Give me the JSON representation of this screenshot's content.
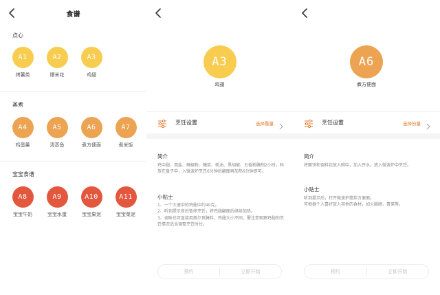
{
  "panel1": {
    "title": "食谱",
    "sections": [
      {
        "title": "点心",
        "items": [
          {
            "code": "A1",
            "name": "烤薯类",
            "color": "#f7cc4f"
          },
          {
            "code": "A2",
            "name": "爆米花",
            "color": "#f7cc4f"
          },
          {
            "code": "A3",
            "name": "鸡翅",
            "color": "#f7cc4f"
          }
        ]
      },
      {
        "title": "蒸煮",
        "items": [
          {
            "code": "A4",
            "name": "鸡蛋羹",
            "color": "#eca352"
          },
          {
            "code": "A5",
            "name": "清蒸鱼",
            "color": "#eca352"
          },
          {
            "code": "A6",
            "name": "煮方便面",
            "color": "#eca352"
          },
          {
            "code": "A7",
            "name": "煮米饭",
            "color": "#eca352"
          }
        ]
      },
      {
        "title": "宝宝食谱",
        "items": [
          {
            "code": "A8",
            "name": "宝宝牛奶",
            "color": "#e2573d"
          },
          {
            "code": "A9",
            "name": "宝宝水蛋",
            "color": "#e2573d"
          },
          {
            "code": "A10",
            "name": "宝宝果泥",
            "color": "#e2573d"
          },
          {
            "code": "A11",
            "name": "宝宝菜泥",
            "color": "#e2573d"
          }
        ]
      }
    ]
  },
  "panel2": {
    "code": "A3",
    "name": "鸡翅",
    "settings_label": "烹饪设置",
    "settings_hint": "选择重量",
    "intro_title": "简介",
    "intro_text": "鸡中翅、用盐、辣椒粉、糖浆、蚝油、黑胡椒、五香粉腌制2小时，码放在盘子中，入微波炉烹饪6分钟后翻面再加热6分钟即可。",
    "tips_title": "小贴士",
    "tips": [
      "1、一个大速中的鸡翅中约40克。",
      "2、听到提示音后暂停烹饪，将鸡翅翻面后继续加热。",
      "3、调味也可直接用奥尔良腌料，鸡翅大小不同，需注意观察鸡翅的烹饪情况适当调整烹饪时长。"
    ],
    "btn_schedule": "预约",
    "btn_start": "立即开始"
  },
  "panel3": {
    "code": "A6",
    "name": "煮方便面",
    "settings_label": "烹饪设置",
    "settings_hint": "选择份量",
    "intro_title": "简介",
    "intro_text": "将面饼和调料包放入碗中，加入开水，放入微波炉中烹饪。",
    "tips_title": "小贴士",
    "tips": [
      "听到提示后，打开微波炉搅拌方便面。",
      "可根据个人喜好放入其他的食材，如火腿肠、青菜等。"
    ],
    "btn_schedule": "预约",
    "btn_start": "立即开始"
  },
  "colors": {
    "yellow": "#f7cc4f",
    "orange": "#eca352",
    "red": "#e2573d",
    "accent": "#e07a2c"
  }
}
